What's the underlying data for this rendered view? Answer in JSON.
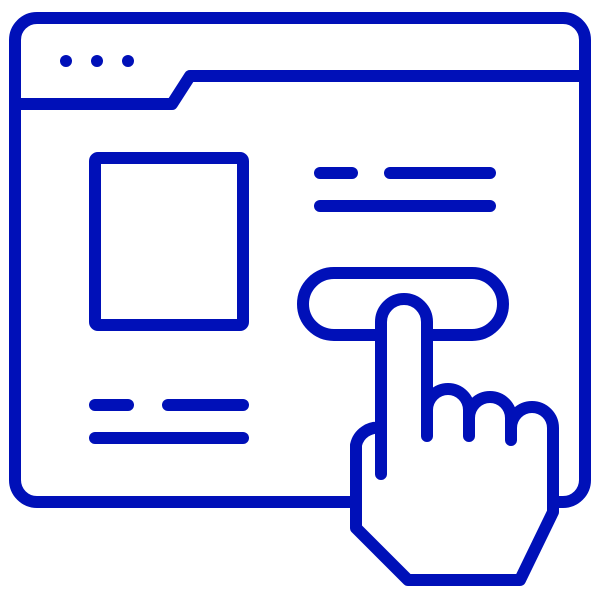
{
  "icon": {
    "name": "web-page-click-icon",
    "description_visible_text": ""
  },
  "colors": {
    "stroke": "#0010B8",
    "background": "#FFFFFF"
  },
  "parts": {
    "window": "browser-window-icon",
    "dots": "window-control-dots-icon",
    "tab": "browser-tab-icon",
    "image": "image-placeholder-icon",
    "text_lines": "text-lines-icon",
    "button": "button-icon",
    "hand": "pointing-hand-icon"
  }
}
